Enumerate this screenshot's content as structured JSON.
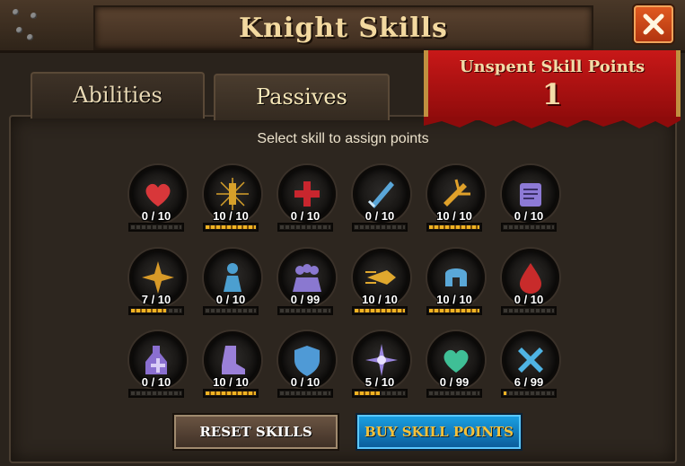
{
  "window": {
    "title": "Knight Skills"
  },
  "tabs": [
    {
      "label": "Abilities",
      "active": false
    },
    {
      "label": "Passives",
      "active": true
    }
  ],
  "banner": {
    "label": "Unspent Skill Points",
    "value": "1"
  },
  "panel": {
    "instruction": "Select skill to assign points"
  },
  "skills": [
    {
      "icon": "heart-icon",
      "color": "#d8373a",
      "count": "0 / 10",
      "progress": 0
    },
    {
      "icon": "sword-burst-icon",
      "color": "#d6a02a",
      "count": "10 / 10",
      "progress": 1
    },
    {
      "icon": "red-cross-icon",
      "color": "#c8262e",
      "count": "0 / 10",
      "progress": 0
    },
    {
      "icon": "blue-sword-icon",
      "color": "#5aa6d8",
      "count": "0 / 10",
      "progress": 0
    },
    {
      "icon": "golden-strike-icon",
      "color": "#e0a12a",
      "count": "10 / 10",
      "progress": 1
    },
    {
      "icon": "scroll-icon",
      "color": "#8d7ad6",
      "count": "0 / 10",
      "progress": 0
    },
    {
      "icon": "golden-spark-icon",
      "color": "#d89a28",
      "count": "7 / 10",
      "progress": 0.7
    },
    {
      "icon": "blue-warrior-icon",
      "color": "#4c9fd0",
      "count": "0 / 10",
      "progress": 0
    },
    {
      "icon": "purple-party-icon",
      "color": "#8a78d0",
      "count": "0 / 99",
      "progress": 0
    },
    {
      "icon": "golden-dash-icon",
      "color": "#e0a82e",
      "count": "10 / 10",
      "progress": 1
    },
    {
      "icon": "blue-helmet-icon",
      "color": "#5aa8d8",
      "count": "10 / 10",
      "progress": 1
    },
    {
      "icon": "blood-drop-icon",
      "color": "#c82b2b",
      "count": "0 / 10",
      "progress": 0
    },
    {
      "icon": "purple-potion-icon",
      "color": "#8a6fd0",
      "count": "0 / 10",
      "progress": 0
    },
    {
      "icon": "purple-boot-icon",
      "color": "#9a80d8",
      "count": "10 / 10",
      "progress": 1
    },
    {
      "icon": "blue-shield-icon",
      "color": "#4f9ad6",
      "count": "0 / 10",
      "progress": 0
    },
    {
      "icon": "purple-star-icon",
      "color": "#9b86e0",
      "count": "5 / 10",
      "progress": 0.5
    },
    {
      "icon": "green-heart-icon",
      "color": "#3fbf96",
      "count": "0 / 99",
      "progress": 0
    },
    {
      "icon": "crossed-swords-icon",
      "color": "#4fb4e4",
      "count": "6 / 99",
      "progress": 0.06
    }
  ],
  "buttons": {
    "reset": "RESET SKILLS",
    "buy": "BUY SKILL POINTS"
  },
  "colors": {
    "banner": "#b01010",
    "accent_gold": "#f0b323",
    "buy_button": "#1a9ee0"
  }
}
